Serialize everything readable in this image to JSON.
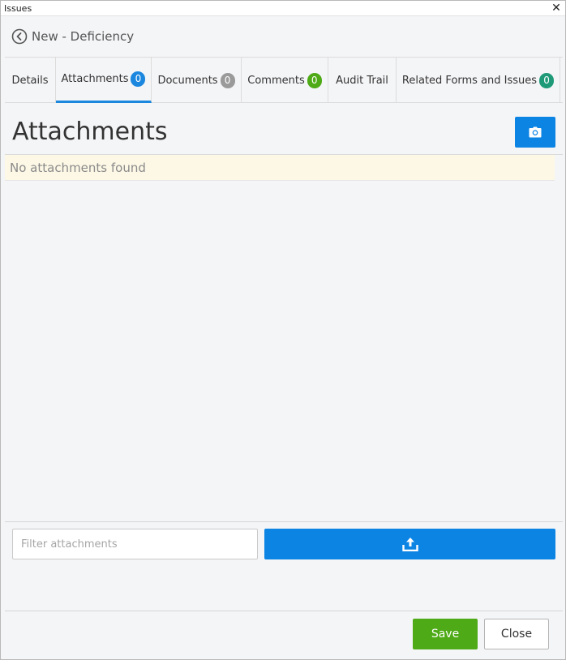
{
  "window": {
    "title": "Issues",
    "close_glyph": "✕"
  },
  "header": {
    "title": "New - Deficiency",
    "back_icon": "chevron-left-circle-icon"
  },
  "tabs": [
    {
      "label": "Details",
      "badge": null
    },
    {
      "label": "Attachments",
      "badge": "0",
      "badge_color": "#1b87df",
      "active": true
    },
    {
      "label": "Documents",
      "badge": "0",
      "badge_color": "#9a9a9a"
    },
    {
      "label": "Comments",
      "badge": "0",
      "badge_color": "#4eaa16"
    },
    {
      "label": "Audit Trail",
      "badge": null
    },
    {
      "label": "Related Forms and Issues",
      "badge": "0",
      "badge_color": "#1f9a78"
    }
  ],
  "section": {
    "title": "Attachments",
    "camera_icon": "camera-icon"
  },
  "attachments": {
    "empty_message": "No attachments found"
  },
  "filter": {
    "placeholder": "Filter attachments",
    "value": ""
  },
  "upload": {
    "icon": "upload-icon"
  },
  "footer": {
    "save_label": "Save",
    "close_label": "Close"
  },
  "colors": {
    "primary": "#0c84e4",
    "success": "#4eaa16",
    "empty_bg": "#fdf8e6"
  }
}
